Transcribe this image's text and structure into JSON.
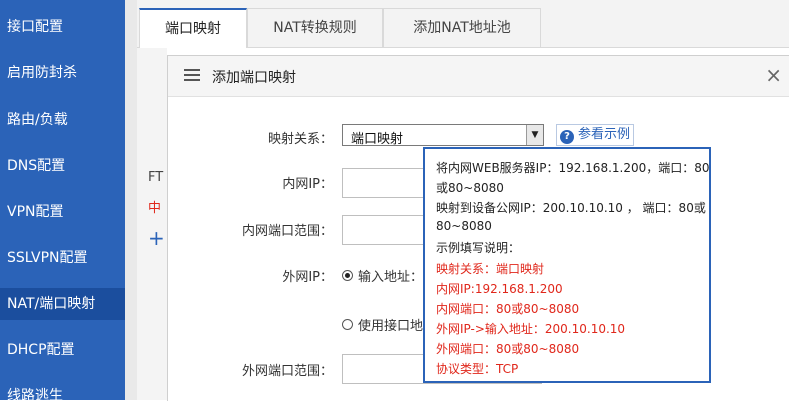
{
  "sidebar": {
    "items": [
      {
        "label": "接口配置"
      },
      {
        "label": "启用防封杀"
      },
      {
        "label": "路由/负载"
      },
      {
        "label": "DNS配置"
      },
      {
        "label": "VPN配置"
      },
      {
        "label": "SSLVPN配置"
      },
      {
        "label": "NAT/端口映射"
      },
      {
        "label": "DHCP配置"
      },
      {
        "label": "线路逃生"
      }
    ],
    "active": "NAT/端口映射"
  },
  "tabs": [
    {
      "label": "端口映射"
    },
    {
      "label": "NAT转换规则"
    },
    {
      "label": "添加NAT地址池"
    }
  ],
  "background": {
    "ft_text": "FT",
    "zh_text": "中",
    "plus_text": "+"
  },
  "dialog": {
    "title": "添加端口映射",
    "close_glyph": "×",
    "mapping_label": "映射关系：",
    "mapping_value": "端口映射",
    "select_arrow": "▼",
    "help_label": "参看示例",
    "help_glyph": "?",
    "inner_ip_label": "内网IP：",
    "inner_port_label": "内网端口范围：",
    "outer_ip_label": "外网IP：",
    "radio_input_label": "输入地址：",
    "radio_interface_label": "使用接口地",
    "outer_port_label": "外网端口范围："
  },
  "tooltip": {
    "lines": [
      "将内网WEB服务器IP：192.168.1.200，端口：80",
      "或80~8080",
      "映射到设备公网IP：200.10.10.10 ， 端口：80或",
      "80~8080",
      "示例填写说明："
    ],
    "example_lines": [
      "映射关系：端口映射",
      "内网IP:192.168.1.200",
      "内网端口：80或80~8080",
      "外网IP->输入地址：200.10.10.10",
      "外网端口：80或80~8080",
      "协议类型：TCP"
    ],
    "example_color": "#e0271b"
  },
  "colors": {
    "sidebar_bg": "#2b63b8",
    "sidebar_active": "#1b4e9e",
    "tooltip_border": "#2b63b8"
  }
}
